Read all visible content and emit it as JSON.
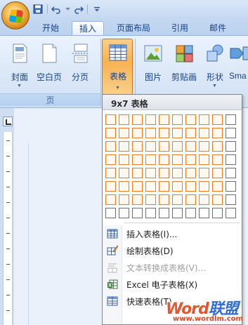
{
  "quick_access": {
    "save_icon": "save-icon",
    "undo_icon": "undo-icon",
    "redo_icon": "redo-icon",
    "customize_icon": "chevron-down-icon"
  },
  "tabs": [
    {
      "label": "开始",
      "active": false
    },
    {
      "label": "插入",
      "active": true
    },
    {
      "label": "页面布局",
      "active": false
    },
    {
      "label": "引用",
      "active": false
    },
    {
      "label": "邮件",
      "active": false
    }
  ],
  "ribbon": {
    "buttons": [
      {
        "label": "封面",
        "icon": "cover-page-icon"
      },
      {
        "label": "空白页",
        "icon": "blank-page-icon"
      },
      {
        "label": "分页",
        "icon": "page-break-icon"
      },
      {
        "label": "表格",
        "icon": "table-icon",
        "pressed": true
      },
      {
        "label": "图片",
        "icon": "picture-icon"
      },
      {
        "label": "剪贴画",
        "icon": "clip-art-icon"
      },
      {
        "label": "形状",
        "icon": "shapes-icon"
      },
      {
        "label": "Sma",
        "icon": "smartart-icon"
      }
    ],
    "group_label": "页"
  },
  "table_menu": {
    "title": "9x7 表格",
    "grid_columns": 10,
    "grid_rows": 8,
    "selected_columns": 9,
    "selected_rows": 7,
    "items": [
      {
        "label": "插入表格(I)...",
        "icon": "insert-table-icon",
        "disabled": false
      },
      {
        "label": "绘制表格(D)",
        "icon": "draw-table-icon",
        "disabled": false
      },
      {
        "label": "文本转换成表格(V)...",
        "icon": "text-to-table-icon",
        "disabled": true
      },
      {
        "label": "Excel 电子表格(X)",
        "icon": "excel-icon",
        "disabled": false
      },
      {
        "label": "快速表格(T)",
        "icon": "quick-table-icon",
        "disabled": false
      }
    ]
  },
  "watermark": {
    "brand_part1": "Word",
    "brand_part2": "联盟",
    "url": "www.wordlm.com"
  },
  "colors": {
    "ribbon_blue": "#15428b",
    "selected_orange": "#f07a1f",
    "pressed_button": "#f8b14f"
  }
}
